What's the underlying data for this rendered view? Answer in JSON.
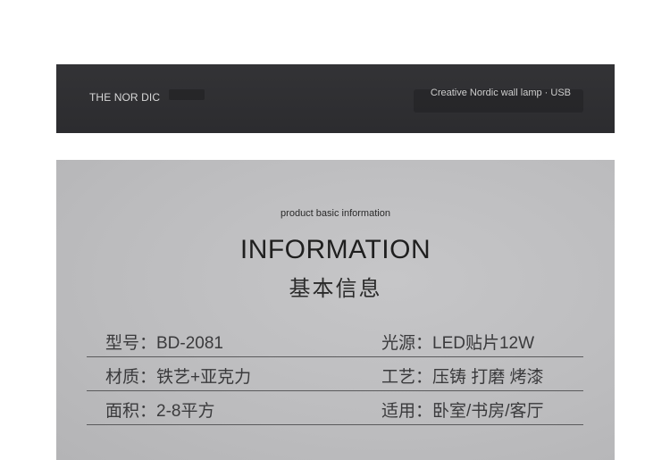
{
  "banner": {
    "brand": "THE NOR DIC",
    "tagline": "Creative Nordic wall lamp · USB"
  },
  "info": {
    "subtitle": "product basic information",
    "title": "INFORMATION",
    "title_cn": "基本信息"
  },
  "specs": [
    {
      "left": "型号：BD-2081",
      "right": "光源：LED贴片12W"
    },
    {
      "left": "材质：铁艺+亚克力",
      "right": "工艺：压铸 打磨 烤漆"
    },
    {
      "left": "面积：2-8平方",
      "right": "适用：卧室/书房/客厅"
    }
  ]
}
